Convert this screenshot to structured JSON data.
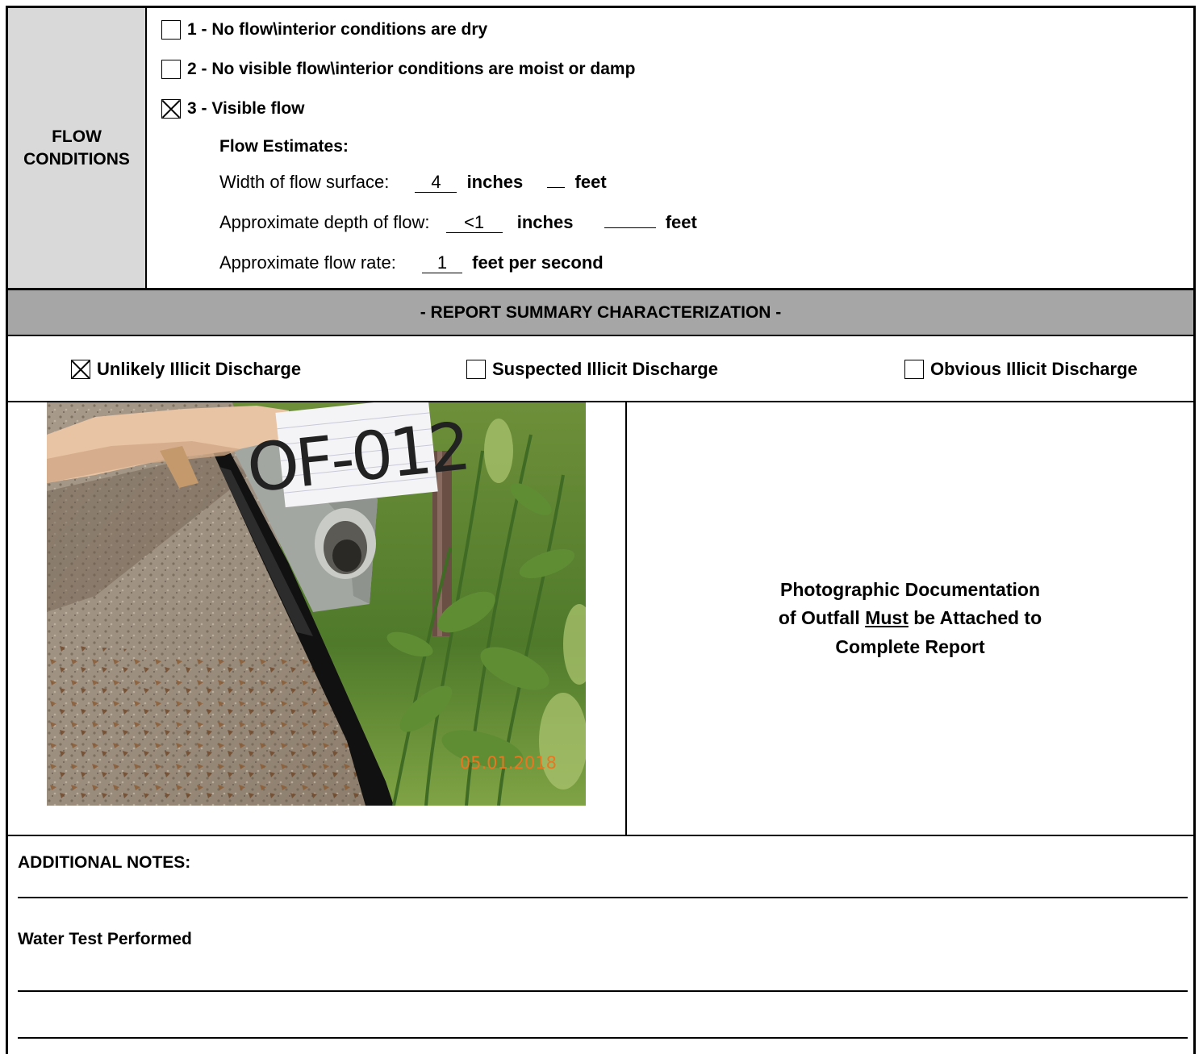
{
  "flow_conditions": {
    "label_line1": "FLOW",
    "label_line2": "CONDITIONS",
    "options": [
      {
        "label": "1 - No flow\\interior conditions are dry",
        "checked": false
      },
      {
        "label": "2 - No visible flow\\interior conditions are moist or damp",
        "checked": false
      },
      {
        "label": "3 - Visible flow",
        "checked": true
      }
    ],
    "estimates": {
      "heading": "Flow Estimates:",
      "width": {
        "label": "Width of flow surface:",
        "inches_value": "4",
        "inches_unit": "inches",
        "feet_value": "",
        "feet_unit": "feet"
      },
      "depth": {
        "label": "Approximate depth of flow:",
        "inches_value": "<1",
        "inches_unit": "inches",
        "feet_value": "",
        "feet_unit": "feet"
      },
      "rate": {
        "label": "Approximate flow rate:",
        "value": "1",
        "unit": "feet per second"
      }
    }
  },
  "summary": {
    "header": "- REPORT SUMMARY CHARACTERIZATION -",
    "options": [
      {
        "label": "Unlikely Illicit Discharge",
        "checked": true
      },
      {
        "label": "Suspected Illicit Discharge",
        "checked": false
      },
      {
        "label": "Obvious Illicit Discharge",
        "checked": false
      }
    ]
  },
  "photo": {
    "sign_text": "OF-012",
    "date_stamp": "05.01.2018"
  },
  "documentation": {
    "line1": "Photographic Documentation",
    "line2_pre": "of Outfall ",
    "line2_em": "Must",
    "line2_post": " be Attached to",
    "line3": "Complete Report"
  },
  "notes": {
    "heading": "ADDITIONAL NOTES:",
    "entry": "Water Test Performed"
  },
  "colors": {
    "label_bg": "#d9d9d9",
    "header_bg": "#a6a6a6",
    "date_stamp": "#e87722"
  }
}
